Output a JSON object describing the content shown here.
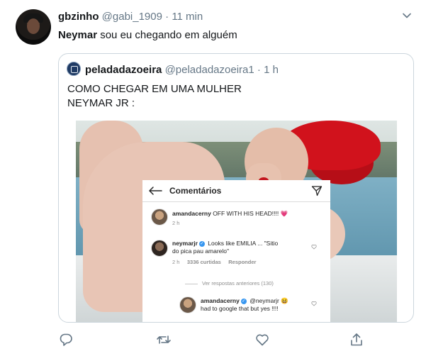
{
  "tweet": {
    "display_name": "gbzinho",
    "handle": "@gabi_1909",
    "separator": "·",
    "time": "11 min",
    "text_bold": "Neymar",
    "text_rest": " sou eu chegando em alguém"
  },
  "quoted": {
    "display_name": "peladadazoeira",
    "handle": "@peladadazoeira1",
    "separator": "·",
    "time": "1 h",
    "text": "COMO CHEGAR EM UMA MULHER\nNEYMAR JR :"
  },
  "instagram": {
    "title": "Comentários",
    "comments": [
      {
        "user": "amandacerny",
        "text": "OFF WITH HIS HEAD!!!!",
        "emoji": "💗",
        "age": "2 h"
      },
      {
        "user": "neymarjr",
        "text": "Looks like EMILIA ... \"Sitio",
        "text2": "do pica pau amarelo\"",
        "age": "2 h",
        "likes": "3336 curtidas",
        "reply": "Responder"
      },
      {
        "user": "amandacerny",
        "mention": "@neymarjr",
        "emoji": "😆",
        "text2": "had to google that but yes !!!!"
      }
    ],
    "view_previous": "Ver respostas anteriores (130)"
  },
  "icons": {
    "caret": "chevron-down-icon",
    "reply": "reply-icon",
    "retweet": "retweet-icon",
    "like": "heart-icon",
    "share": "share-icon"
  },
  "colors": {
    "text": "#14171a",
    "muted": "#657786",
    "border": "#ccd6dd",
    "ig_verified": "#3897f0"
  }
}
